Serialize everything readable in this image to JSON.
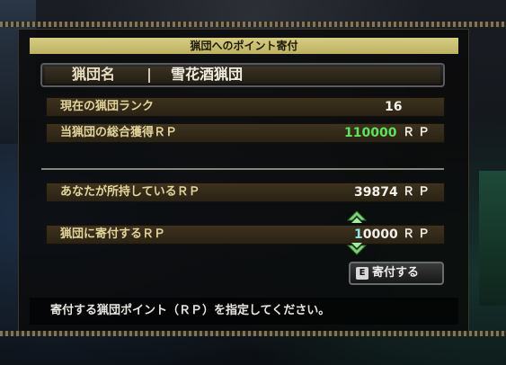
{
  "panel": {
    "title": "猟団へのポイント寄付"
  },
  "hunting_group": {
    "name_label": "猟団名",
    "name_value": "雪花酒猟団"
  },
  "stats": {
    "rank_label": "現在の猟団ランク",
    "rank_value": "16",
    "total_rp_label": "当猟団の総合獲得ＲＰ",
    "total_rp_value": "110000",
    "total_rp_unit": "ＲＰ"
  },
  "donation": {
    "owned_label": "あなたが所持しているＲＰ",
    "owned_value": "39874",
    "owned_unit": "ＲＰ",
    "donate_label": "猟団に寄付するＲＰ",
    "donate_value_first_digit": "1",
    "donate_value_rest": "0000",
    "donate_unit": "ＲＰ",
    "button_key": "E",
    "button_label": "寄付する"
  },
  "footer": {
    "instruction": "寄付する猟団ポイント（ＲＰ）を指定してください。"
  },
  "colors": {
    "title_bg": "#d6cd83",
    "row_bg": "#3e321e",
    "label_text": "#e2d49a",
    "highlight_green": "#5fe25c",
    "cursor_cyan": "#8ee6e0",
    "arrow_green": "#7fd67a"
  },
  "icons": {
    "increase": "arrow-up-icon",
    "decrease": "arrow-down-icon",
    "key": "e-key-icon"
  }
}
